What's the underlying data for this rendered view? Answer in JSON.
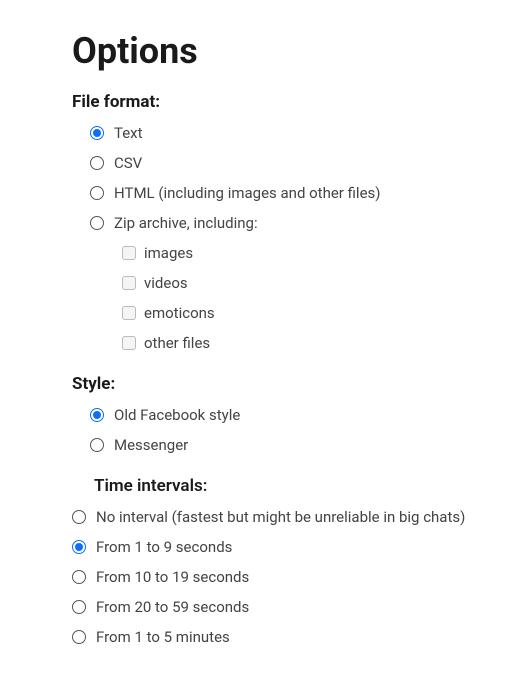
{
  "title": "Options",
  "fileFormat": {
    "label": "File format:",
    "options": [
      {
        "label": "Text",
        "checked": true
      },
      {
        "label": "CSV",
        "checked": false
      },
      {
        "label": "HTML (including images and other files)",
        "checked": false
      },
      {
        "label": "Zip archive, including:",
        "checked": false
      }
    ],
    "zipIncludes": [
      {
        "label": "images",
        "checked": false
      },
      {
        "label": "videos",
        "checked": false
      },
      {
        "label": "emoticons",
        "checked": false
      },
      {
        "label": "other files",
        "checked": false
      }
    ]
  },
  "style": {
    "label": "Style:",
    "options": [
      {
        "label": "Old Facebook style",
        "checked": true
      },
      {
        "label": "Messenger",
        "checked": false
      }
    ]
  },
  "timeIntervals": {
    "label": "Time intervals:",
    "options": [
      {
        "label": "No interval (fastest but might be unreliable in big chats)",
        "checked": false
      },
      {
        "label": "From 1 to 9 seconds",
        "checked": true
      },
      {
        "label": "From 10 to 19 seconds",
        "checked": false
      },
      {
        "label": "From 20 to 59 seconds",
        "checked": false
      },
      {
        "label": "From 1 to 5 minutes",
        "checked": false
      }
    ]
  }
}
